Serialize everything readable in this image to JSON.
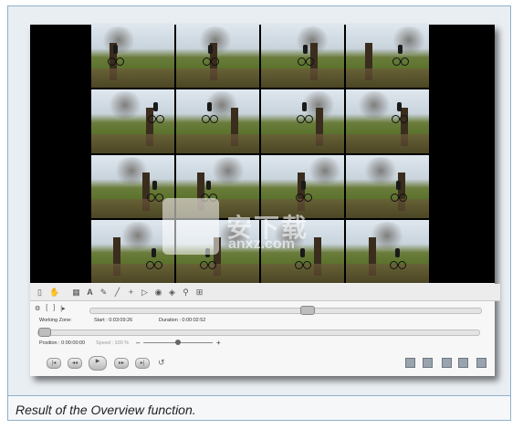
{
  "caption": "Result of the Overview function.",
  "watermark": {
    "main": "安下载",
    "sub": "anxz.com"
  },
  "controls": {
    "working_zone_label": "Working Zone:",
    "start": "Start : 0:03:09:26",
    "duration": "Duration : 0:00:02:52",
    "position": "Position : 0:00:00:00",
    "speed": "Speed : 100 %",
    "speed_level": 0.5,
    "position_level": 0.0
  },
  "toolbar_icons": [
    "page-icon",
    "hand-icon",
    "rect-icon",
    "text-icon",
    "pen-icon",
    "line-icon",
    "point-icon",
    "arrow-icon",
    "circle-icon",
    "multi-icon",
    "zoom-icon",
    "grid-icon"
  ],
  "playback_icons": [
    "skip-start-icon",
    "step-back-icon",
    "play-icon",
    "step-forward-icon",
    "skip-end-icon",
    "loop-icon"
  ],
  "right_icons": [
    "camera-icon",
    "copy-icon",
    "save-icon",
    "export-icon",
    "export2-icon"
  ]
}
